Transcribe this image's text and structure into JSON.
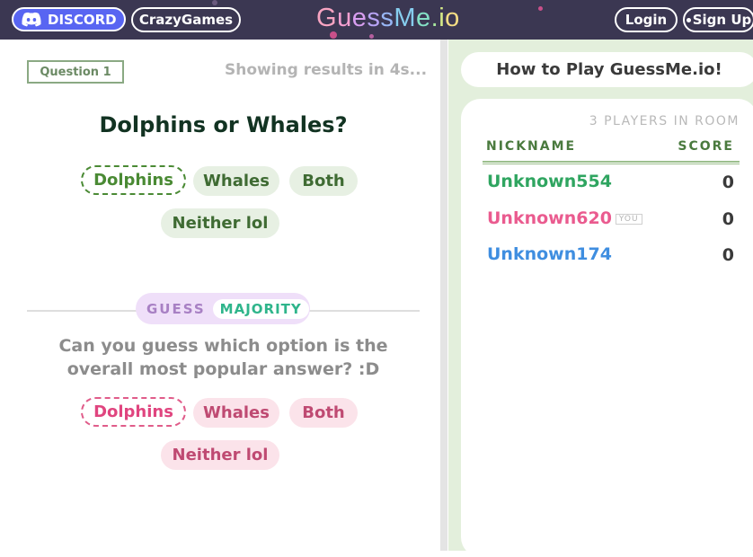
{
  "header": {
    "discord_label": "DISCORD",
    "crazygames_label": "CrazyGames",
    "logo": [
      {
        "ch": "G",
        "color": "#f8a4c2"
      },
      {
        "ch": "u",
        "color": "#f59fd0"
      },
      {
        "ch": "e",
        "color": "#d89ef0"
      },
      {
        "ch": "s",
        "color": "#b8a4f5"
      },
      {
        "ch": "s",
        "color": "#98b6f5"
      },
      {
        "ch": "M",
        "color": "#86cdee"
      },
      {
        "ch": "e",
        "color": "#84e0c6"
      },
      {
        "ch": ".",
        "color": "#a6e69c"
      },
      {
        "ch": "i",
        "color": "#d6ea88"
      },
      {
        "ch": "o",
        "color": "#f2dc84"
      }
    ],
    "login_label": "Login",
    "signup_label": "Sign Up"
  },
  "question": {
    "label": "Question 1",
    "timer": "Showing results in 4s...",
    "title": "Dolphins or Whales?",
    "options": [
      "Dolphins",
      "Whales",
      "Both",
      "Neither lol"
    ],
    "selected": "Dolphins"
  },
  "guess": {
    "mode_word": "GUESS",
    "mode_tag": "MAJORITY",
    "text": "Can you guess which option is the overall most popular answer? :D",
    "options": [
      "Dolphins",
      "Whales",
      "Both",
      "Neither lol"
    ],
    "selected": "Dolphins"
  },
  "sidebar": {
    "howto_label": "How to Play GuessMe.io!",
    "players_count": "3 PLAYERS IN ROOM",
    "col_nickname": "NICKNAME",
    "col_score": "SCORE",
    "you_tag": "YOU",
    "players": [
      {
        "name": "Unknown554",
        "score": "0",
        "color": "#2fa560",
        "you": false
      },
      {
        "name": "Unknown620",
        "score": "0",
        "color": "#ea5b8f",
        "you": true
      },
      {
        "name": "Unknown174",
        "score": "0",
        "color": "#3f8ee0",
        "you": false
      }
    ]
  },
  "colors": {
    "topbar": "#3b3752",
    "discord": "#5865f2",
    "sidebar": "#e3efdc"
  }
}
